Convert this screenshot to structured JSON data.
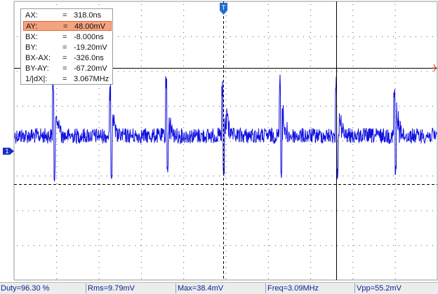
{
  "scope": {
    "channel_label": "1",
    "trigger_label": "T",
    "colors": {
      "trace": "#1010e0",
      "grid": "#000000",
      "cursor": "#000000",
      "marker_channel": "#1a2bcb",
      "marker_trigger": "#1f6fd0",
      "marker_cursor": "#d04010"
    }
  },
  "cursor_readout": {
    "rows": [
      {
        "key": "AX:",
        "eq": "=",
        "value": "318.0ns"
      },
      {
        "key": "AY:",
        "eq": "=",
        "value": "48.00mV",
        "highlight": true
      },
      {
        "key": "BX:",
        "eq": "=",
        "value": "-8.000ns"
      },
      {
        "key": "BY:",
        "eq": "=",
        "value": "-19.20mV"
      },
      {
        "key": "BX-AX:",
        "eq": "=",
        "value": "-326.0ns"
      },
      {
        "key": "BY-AY:",
        "eq": "=",
        "value": "-67.20mV"
      },
      {
        "key": "1/|dX|:",
        "eq": "=",
        "value": "3.067MHz"
      }
    ]
  },
  "measurements": [
    {
      "label": "Duty=96.30 %"
    },
    {
      "label": "Rms=9.79mV"
    },
    {
      "label": "Max=38.4mV"
    },
    {
      "label": "Freq=3.09MHz"
    },
    {
      "label": "Vpp=55.2mV"
    }
  ]
}
